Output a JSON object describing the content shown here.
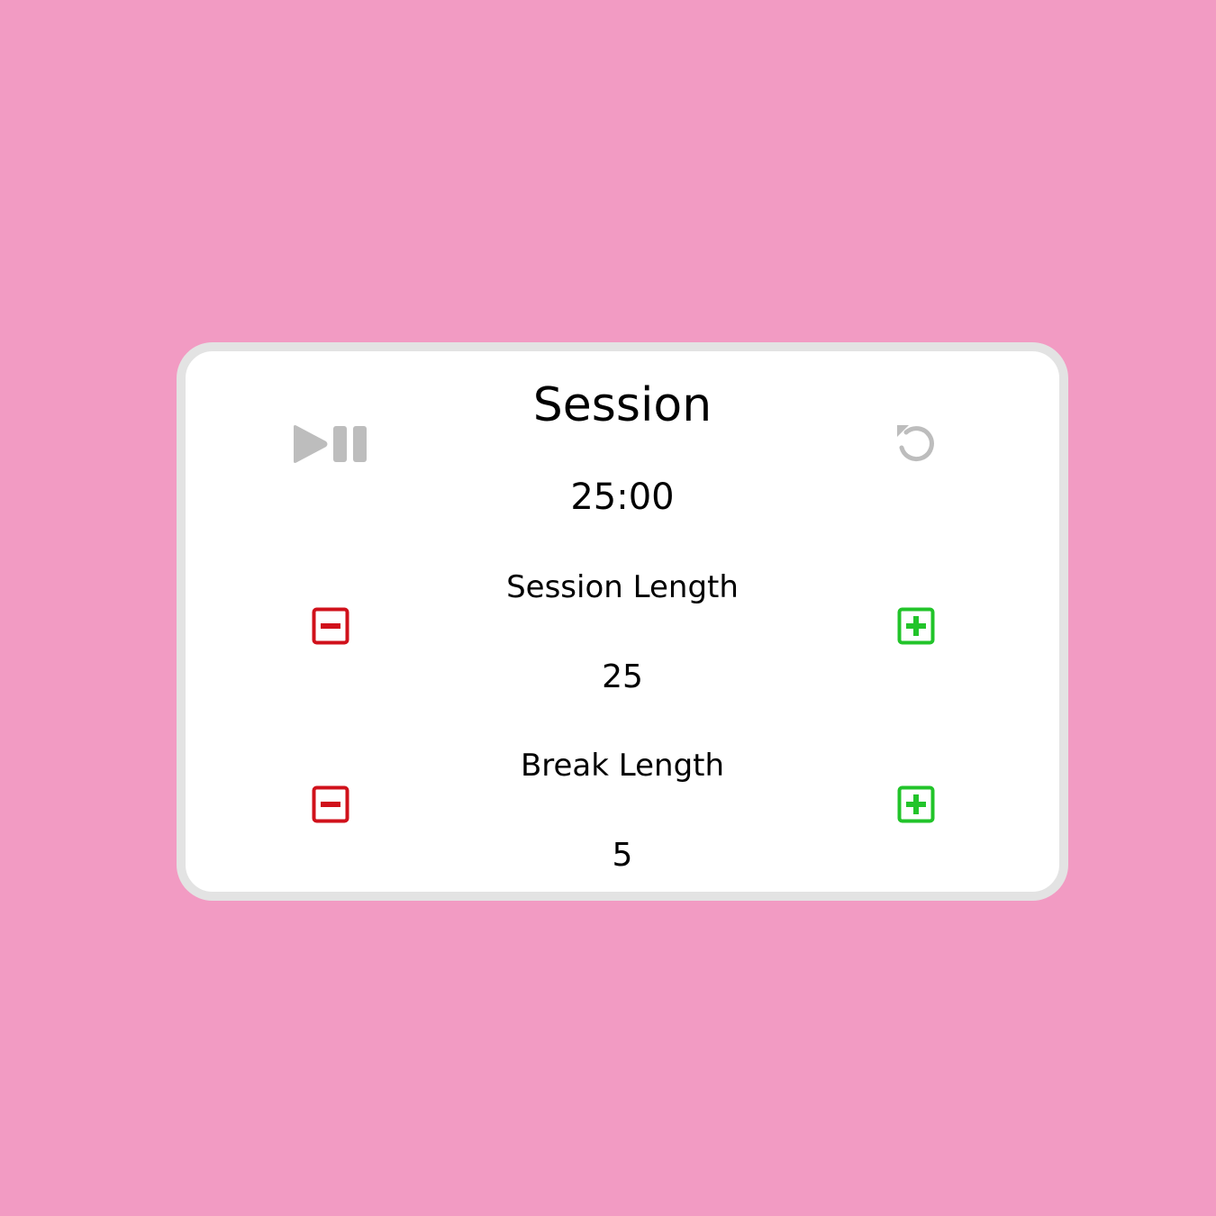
{
  "timer": {
    "label": "Session",
    "time": "25:00"
  },
  "controls": {
    "play_pause_icon": "play-pause-icon",
    "reset_icon": "reset-icon"
  },
  "session_length": {
    "label": "Session Length",
    "value": "25",
    "decrement_icon": "minus-square-icon",
    "increment_icon": "plus-square-icon"
  },
  "break_length": {
    "label": "Break Length",
    "value": "5",
    "decrement_icon": "minus-square-icon",
    "increment_icon": "plus-square-icon"
  },
  "colors": {
    "background": "#f29bc3",
    "card": "#ffffff",
    "card_border": "#e3e3e3",
    "control_gray": "#bdbdbd",
    "decrement_red": "#d0111b",
    "increment_green": "#22c42a"
  }
}
